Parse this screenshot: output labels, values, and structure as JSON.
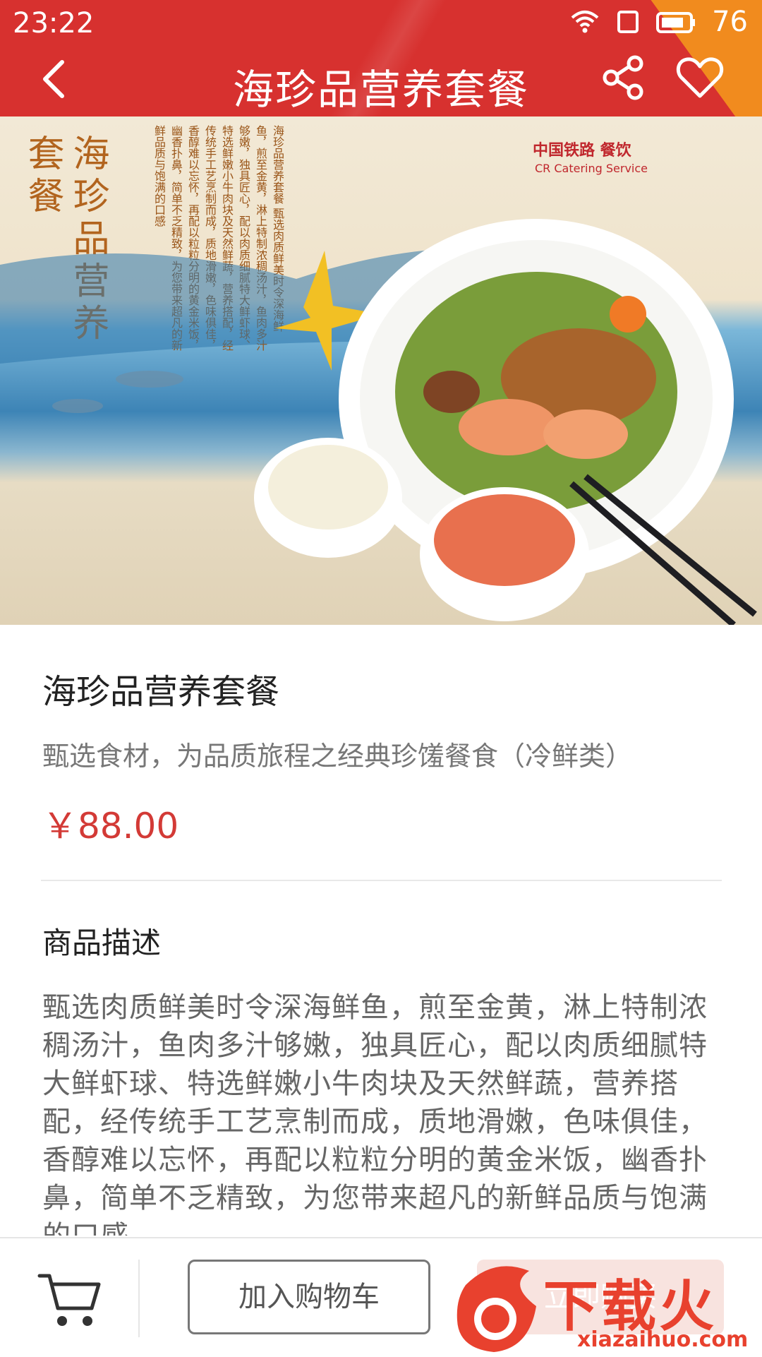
{
  "status_bar": {
    "time": "23:22",
    "battery": "76"
  },
  "nav": {
    "title": "海珍品营养套餐"
  },
  "banner": {
    "vertical_title": "海珍品营养套餐",
    "vertical_text": "海珍品营养套餐 甄选肉质鲜美时令深海鲜鱼，煎至金黄，淋上特制浓稠汤汁，鱼肉多汁够嫩，独具匠心，配以肉质细腻特大鲜虾球、特选鲜嫩小牛肉块及天然鲜蔬，营养搭配，经传统手工艺烹制而成，质地滑嫩，色味俱佳，香醇难以忘怀，再配以粒粒分明的黄金米饭，幽香扑鼻，简单不乏精致，为您带来超凡的新鲜品质与饱满的口感",
    "logo_text": "中国铁路 餐饮",
    "logo_sub": "CR Catering Service"
  },
  "product": {
    "name": "海珍品营养套餐",
    "subtitle": "甄选食材，为品质旅程之经典珍馐餐食（冷鲜类）",
    "price": "￥88.00"
  },
  "description": {
    "heading": "商品描述",
    "body": "甄选肉质鲜美时令深海鲜鱼，煎至金黄，淋上特制浓稠汤汁，鱼肉多汁够嫩，独具匠心，配以肉质细腻特大鲜虾球、特选鲜嫩小牛肉块及天然鲜蔬，营养搭配，经传统手工艺烹制而成，质地滑嫩，色味俱佳，香醇难以忘怀，再配以粒粒分明的黄金米饭，幽香扑鼻，简单不乏精致，为您带来超凡的新鲜品质与饱满的口感"
  },
  "bottom_bar": {
    "add_to_cart": "加入购物车",
    "buy_now": "立即购买"
  },
  "watermark": {
    "text": "下载火",
    "url": "xiazaihuo.com"
  },
  "colors": {
    "header_red": "#d7312f",
    "header_orange": "#f18b1e",
    "price_red": "#d33a36"
  }
}
